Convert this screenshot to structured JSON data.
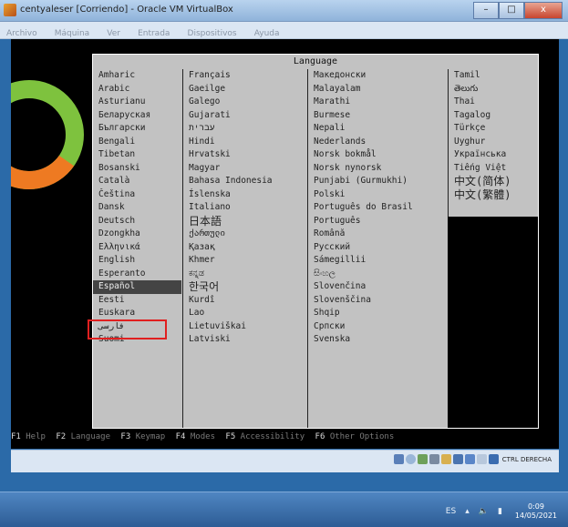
{
  "window": {
    "title": "centyaleser [Corriendo] - Oracle VM VirtualBox",
    "minimize_label": "–",
    "maximize_label": "□",
    "close_label": "x"
  },
  "menu": [
    "Archivo",
    "Máquina",
    "Ver",
    "Entrada",
    "Dispositivos",
    "Ayuda"
  ],
  "dialog": {
    "title": "Language",
    "columns": [
      [
        "Amharic",
        "Arabic",
        "Asturianu",
        "Беларуская",
        "Български",
        "Bengali",
        "Tibetan",
        "Bosanski",
        "Català",
        "Čeština",
        "Dansk",
        "Deutsch",
        "Dzongkha",
        "Ελληνικά",
        "English",
        "Esperanto",
        "Español",
        "Eesti",
        "Euskara",
        "فارسی",
        "Suomi"
      ],
      [
        "Français",
        "Gaeilge",
        "Galego",
        "Gujarati",
        "עברית",
        "Hindi",
        "Hrvatski",
        "Magyar",
        "Bahasa Indonesia",
        "Íslenska",
        "Italiano",
        "日本語",
        "ქართული",
        "Қазақ",
        "Khmer",
        "ಕನ್ನಡ",
        "한국어",
        "Kurdî",
        "Lao",
        "Lietuviškai",
        "Latviski"
      ],
      [
        "Македонски",
        "Malayalam",
        "Marathi",
        "Burmese",
        "Nepali",
        "Nederlands",
        "Norsk bokmål",
        "Norsk nynorsk",
        "Punjabi (Gurmukhi)",
        "Polski",
        "Português do Brasil",
        "Português",
        "Română",
        "Русский",
        "Sámegillii",
        "සිංහල",
        "Slovenčina",
        "Slovenščina",
        "Shqip",
        "Српски",
        "Svenska"
      ],
      [
        "Tamil",
        "తెలుగు",
        "Thai",
        "Tagalog",
        "Türkçe",
        "Uyghur",
        "Українська",
        "Tiếng Việt",
        "中文(简体)",
        "中文(繁體)"
      ]
    ],
    "selected": "Español"
  },
  "fkeys": [
    {
      "key": "F1",
      "label": "Help"
    },
    {
      "key": "F2",
      "label": "Language"
    },
    {
      "key": "F3",
      "label": "Keymap"
    },
    {
      "key": "F4",
      "label": "Modes"
    },
    {
      "key": "F5",
      "label": "Accessibility"
    },
    {
      "key": "F6",
      "label": "Other Options"
    }
  ],
  "statusbar": {
    "host_key": "CTRL DERECHA",
    "icons": [
      "hdd-icon",
      "cd-icon",
      "network-icon",
      "usb-icon",
      "shared-folder-icon",
      "display-icon",
      "record-icon",
      "mouse-icon",
      "keyboard-icon"
    ]
  },
  "taskbar": {
    "lang": "ES",
    "time": "0:09",
    "date": "14/05/2021"
  },
  "colors": {
    "accent_green": "#7ec23e",
    "accent_orange": "#ee7a22",
    "selection_highlight": "#e02020"
  }
}
